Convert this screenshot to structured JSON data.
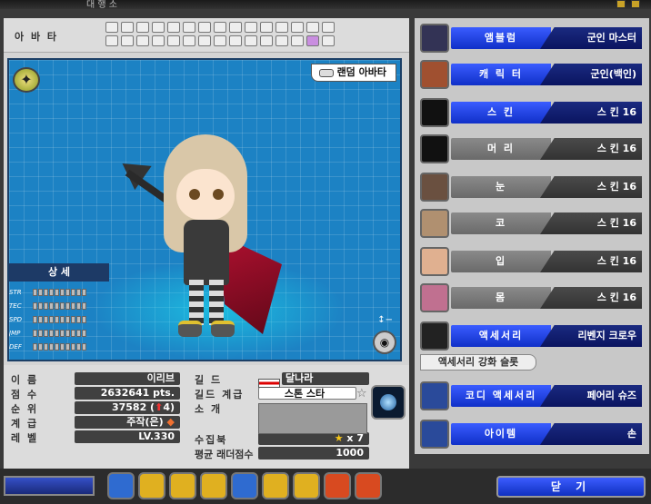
{
  "window": {
    "title": "대 행 소"
  },
  "avatar_row": {
    "label": "아 바 타",
    "slot_count": 30,
    "selected_slot": 28
  },
  "stage": {
    "random_avatar_label": "랜덤 아바타",
    "detail_tab": "상 세",
    "zoom_label": "↕−",
    "stats": [
      {
        "name": "STR",
        "bars": 10
      },
      {
        "name": "TEC",
        "bars": 10
      },
      {
        "name": "SPD",
        "bars": 10
      },
      {
        "name": "JMP",
        "bars": 10
      },
      {
        "name": "DEF",
        "bars": 10
      }
    ]
  },
  "info": {
    "name_label": "이 름",
    "name_value": "이리브",
    "score_label": "점 수",
    "score_value": "2632641 pts.",
    "rank_label": "순 위",
    "rank_value": "37582 (",
    "rank_change": "4)",
    "grade_label": "계 급",
    "grade_value": "주작(은)",
    "level_label": "레 벨",
    "level_value": "LV.330",
    "guild_label": "길 드",
    "guild_value": "달나라",
    "guild_rank_label": "길드 계급",
    "guild_rank_value": "스톤 스타",
    "intro_label": "소 개",
    "intro_value": "",
    "collection_label": "수집북",
    "collection_value": "x 7",
    "ladder_label": "평균 래더점수",
    "ladder_value": "1000"
  },
  "equipment": [
    {
      "category": "앰블럼",
      "value": "군인 마스터",
      "style": "blue",
      "icon": "emblem-icon"
    },
    {
      "category": "캐 릭 터",
      "value": "군인(백인)",
      "style": "blue",
      "icon": "character-icon"
    },
    {
      "category": "스 킨",
      "value": "스 킨 16",
      "style": "blue",
      "icon": "skin-icon"
    },
    {
      "category": "머 리",
      "value": "스 킨 16",
      "style": "gray",
      "icon": "hair-icon"
    },
    {
      "category": "눈",
      "value": "스 킨 16",
      "style": "gray",
      "icon": "eye-icon"
    },
    {
      "category": "코",
      "value": "스 킨 16",
      "style": "gray",
      "icon": "nose-icon"
    },
    {
      "category": "입",
      "value": "스 킨 16",
      "style": "gray",
      "icon": "mouth-icon"
    },
    {
      "category": "몸",
      "value": "스 킨 16",
      "style": "gray",
      "icon": "body-icon"
    },
    {
      "category": "액세서리",
      "value": "리벤지 크로우",
      "style": "blue",
      "icon": "accessory-icon"
    },
    {
      "category": "코디 액세서리",
      "value": "페어리 슈즈",
      "style": "blue",
      "icon": "coordi-accessory-icon"
    },
    {
      "category": "아이템",
      "value": "손",
      "style": "blue",
      "icon": "hand-icon"
    }
  ],
  "accessory_slot_label": "액세서리 강화 슬롯",
  "close_button": "닫 기",
  "colors": {
    "accent_blue": "#1030c8",
    "stage_bg": "#1c82c4"
  }
}
